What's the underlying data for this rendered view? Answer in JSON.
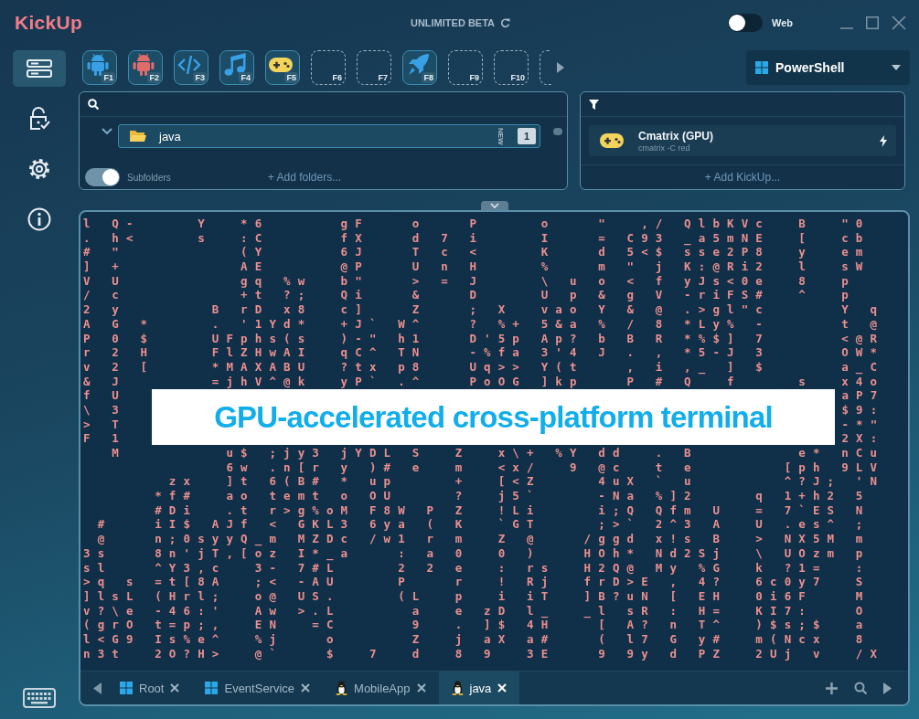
{
  "app": {
    "name": "KickUp",
    "edition": "UNLIMITED BETA"
  },
  "web_toggle": {
    "label": "Web",
    "on": false
  },
  "sidebar": {
    "items": [
      {
        "kind": "launcher",
        "selected": true
      },
      {
        "kind": "lock",
        "selected": false
      },
      {
        "kind": "settings",
        "selected": false
      },
      {
        "kind": "info",
        "selected": false
      }
    ]
  },
  "hotkeys": [
    {
      "key": "F1",
      "kind": "android",
      "color": "#3aa0e6"
    },
    {
      "key": "F2",
      "kind": "android",
      "color": "#e06b6b"
    },
    {
      "key": "F3",
      "kind": "code",
      "color": "#3aa0e6"
    },
    {
      "key": "F4",
      "kind": "music",
      "color": "#3aa0e6"
    },
    {
      "key": "F5",
      "kind": "gamepad",
      "color": "#f2d45c"
    },
    {
      "key": "F6",
      "kind": "empty"
    },
    {
      "key": "F7",
      "kind": "empty"
    },
    {
      "key": "F8",
      "kind": "rocket",
      "color": "#3aa0e6"
    },
    {
      "key": "F9",
      "kind": "empty"
    },
    {
      "key": "F10",
      "kind": "empty"
    },
    {
      "kind": "empty"
    }
  ],
  "shell_select": {
    "value": "PowerShell"
  },
  "folders": {
    "items": [
      {
        "name": "java",
        "expanded": true,
        "tag": "NEW",
        "badge": "1"
      }
    ],
    "subfolders": {
      "label": "Subfolders",
      "on": true
    },
    "add_label": "+ Add folders..."
  },
  "kickups": {
    "items": [
      {
        "name": "Cmatrix (GPU)",
        "command": "cmatrix -C red"
      }
    ],
    "add_label": "+ Add KickUp..."
  },
  "terminal": {
    "banner": "GPU-accelerated cross-platform terminal",
    "lines": [
      "l Q-    Y  *6     gF   o   P    o   \"  ,/ QlbKVc  B  \"0 ",
      ". h<    s  :C     fX   d 7 i    I   = C93 _a5mNE  [  cb ",
      "# \"        (Y     6J   T c <    K   d 5<$ sse2P8  y  em ",
      "] +        AE     @P   U n H    %   m \" j K:@Ri2  l  sW ",
      "V U        gq %w  b\"   > = J    \\ u o < f yJs<0e  8  p  ",
      "/ c        +t ?;  Qi   &   D    U p & g V -riFS#  ^  p  ",
      "2 y      B rD x8  c]   Z   ; X  vao Y & @ .>gl\"c     Y q",
      "A G *    . '1Yd*  +J` W^   ? %+ 5&a % / 8 *Ly% -     t @",
      "P 0 $    UFphs(s  )-\" h1   D'5p Ap? b B R *%$] 7     <@R",
      "r 2 H    FlZHwAI  qC^ TN   -%fa 3'4 J . , *5-J 3     OW*",
      "v 2 [    *MAXABU  ?tx p8   Uq>> Y(t   , i ,_ ] $     a_C",
      "& J      =jhV^@k  yP` .^   PoOG ]kp   P # Q  f    s  x4o",
      "f U                                                  aP7",
      "\\ 3                                                  $9:",
      "> T                                                  -*\"",
      "F 1                                                  2X:",
      "  M       u$ ;jy3 jYDL S  Z  x\\+ %Y dd  . B       e* nCu",
      "          6w .n[r y )# e  m  <x/  9 @c  t e      [ph 9LV",
      "      zx  ]t 6(B# * up    +  [<Z    4uX ` u      ^?J; 'N",
      "     *f#  ao temt o OU    ?  j5`    -Na %]2    q 1+h2 5 ",
      "     #Di  .t r>g%oM F8W P Z  !Li    i;Q Qfm U  = 7`ES N ",
      " #   iI$ AJf < GKL3 6ya ( K  `GT    ;>` 2^3 A  U .es^ ; ",
      " @   n;0syyQ_m MZDc /w1 r m  Z @   /ggd x!s B  > NX5M m ",
      "3s   8n'jT,[oz I*_a   : a 0  0 )   HOh* Nd2Sj  \\ UOzm p ",
      "sl   ^Y3,c  3- 7#L    2 2 e  : rs  H2Q@ My %G  k ?1=  : ",
      ">q s =t[8A  ;< -AU    P   r  ! Rj  frD>E , 4?  6c0y7  S ",
      "]lsL (Hrl;  o@ US.    (L  p  i iT  ]B?uN [ EH  0i6F   M ",
      "v?\\e -46:'  Aw >.L     a  e zD l_  _l sR : H=  KI7:   O ",
      "(grO t=p;,  EN  =C     9  . ]$ 4H   [ A? n T^  )$s;$  a ",
      "l<G9 Is%e^  %j   o     Z  j aX a#   ( l7 G y#  m(Ncx  8 ",
      "n3t  2O?H>  @`   $  7  d  8 9  3E   9 9y d PZ  2Uj v  /X"
    ]
  },
  "tabs": [
    {
      "label": "Root",
      "kind": "windows",
      "selected": false
    },
    {
      "label": "EventService",
      "kind": "windows",
      "selected": false
    },
    {
      "label": "MobileApp",
      "kind": "linux",
      "selected": false
    },
    {
      "label": "java",
      "kind": "linux",
      "selected": true
    }
  ]
}
